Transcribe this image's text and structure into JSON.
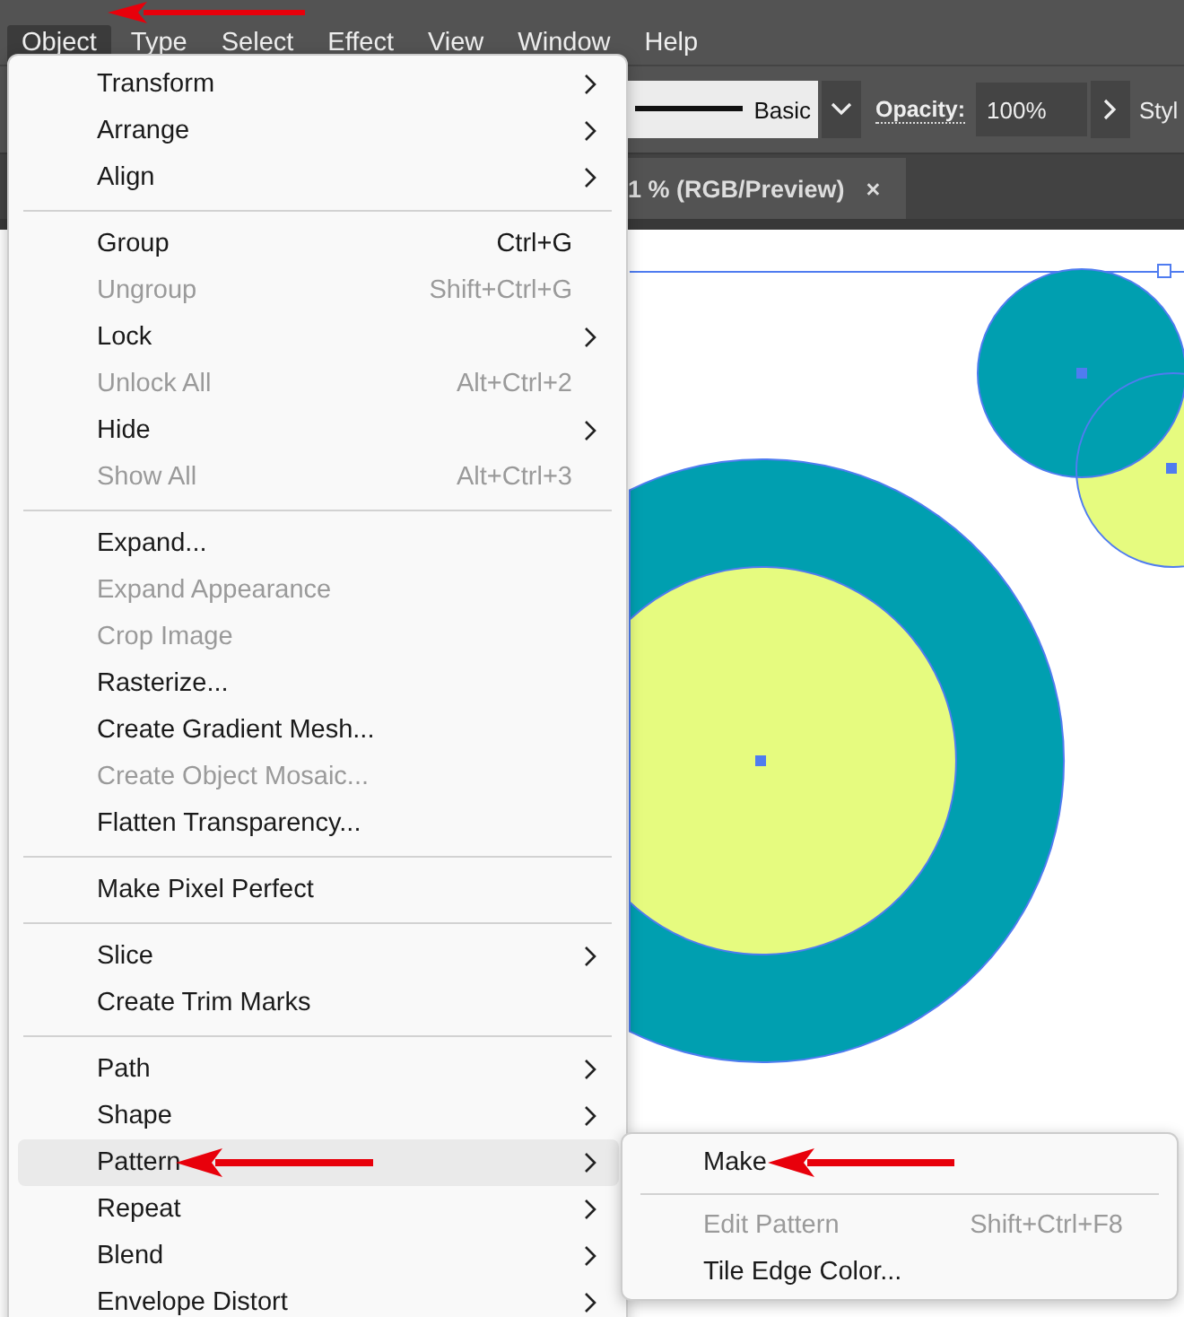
{
  "menubar": [
    {
      "label": "Object",
      "selected": true
    },
    {
      "label": "Type",
      "selected": false
    },
    {
      "label": "Select",
      "selected": false
    },
    {
      "label": "Effect",
      "selected": false
    },
    {
      "label": "View",
      "selected": false
    },
    {
      "label": "Window",
      "selected": false
    },
    {
      "label": "Help",
      "selected": false
    }
  ],
  "control_bar": {
    "stroke_style": "Basic",
    "opacity_label": "Opacity:",
    "opacity_value": "100%",
    "style_label": "Styl"
  },
  "document_tab": {
    "title": "1 % (RGB/Preview)",
    "close": "×"
  },
  "object_menu": [
    [
      {
        "label": "Transform",
        "submenu": true,
        "disabled": false,
        "selected": false
      },
      {
        "label": "Arrange",
        "submenu": true,
        "disabled": false,
        "selected": false
      },
      {
        "label": "Align",
        "submenu": true,
        "disabled": false,
        "selected": false
      }
    ],
    [
      {
        "label": "Group",
        "shortcut": "Ctrl+G",
        "submenu": false,
        "disabled": false,
        "selected": false
      },
      {
        "label": "Ungroup",
        "shortcut": "Shift+Ctrl+G",
        "submenu": false,
        "disabled": true,
        "selected": false
      },
      {
        "label": "Lock",
        "submenu": true,
        "disabled": false,
        "selected": false
      },
      {
        "label": "Unlock All",
        "shortcut": "Alt+Ctrl+2",
        "submenu": false,
        "disabled": true,
        "selected": false
      },
      {
        "label": "Hide",
        "submenu": true,
        "disabled": false,
        "selected": false
      },
      {
        "label": "Show All",
        "shortcut": "Alt+Ctrl+3",
        "submenu": false,
        "disabled": true,
        "selected": false
      }
    ],
    [
      {
        "label": "Expand...",
        "submenu": false,
        "disabled": false,
        "selected": false
      },
      {
        "label": "Expand Appearance",
        "submenu": false,
        "disabled": true,
        "selected": false
      },
      {
        "label": "Crop Image",
        "submenu": false,
        "disabled": true,
        "selected": false
      },
      {
        "label": "Rasterize...",
        "submenu": false,
        "disabled": false,
        "selected": false
      },
      {
        "label": "Create Gradient Mesh...",
        "submenu": false,
        "disabled": false,
        "selected": false
      },
      {
        "label": "Create Object Mosaic...",
        "submenu": false,
        "disabled": true,
        "selected": false
      },
      {
        "label": "Flatten Transparency...",
        "submenu": false,
        "disabled": false,
        "selected": false
      }
    ],
    [
      {
        "label": "Make Pixel Perfect",
        "submenu": false,
        "disabled": false,
        "selected": false
      }
    ],
    [
      {
        "label": "Slice",
        "submenu": true,
        "disabled": false,
        "selected": false
      },
      {
        "label": "Create Trim Marks",
        "submenu": false,
        "disabled": false,
        "selected": false
      }
    ],
    [
      {
        "label": "Path",
        "submenu": true,
        "disabled": false,
        "selected": false
      },
      {
        "label": "Shape",
        "submenu": true,
        "disabled": false,
        "selected": false
      },
      {
        "label": "Pattern",
        "submenu": true,
        "disabled": false,
        "selected": true
      },
      {
        "label": "Repeat",
        "submenu": true,
        "disabled": false,
        "selected": false
      },
      {
        "label": "Blend",
        "submenu": true,
        "disabled": false,
        "selected": false
      },
      {
        "label": "Envelope Distort",
        "submenu": true,
        "disabled": false,
        "selected": false
      }
    ]
  ],
  "pattern_submenu": [
    [
      {
        "label": "Make",
        "disabled": false,
        "selected": false
      }
    ],
    [
      {
        "label": "Edit Pattern",
        "shortcut": "Shift+Ctrl+F8",
        "disabled": true,
        "selected": false
      },
      {
        "label": "Tile Edge Color...",
        "disabled": false,
        "selected": false
      }
    ]
  ]
}
